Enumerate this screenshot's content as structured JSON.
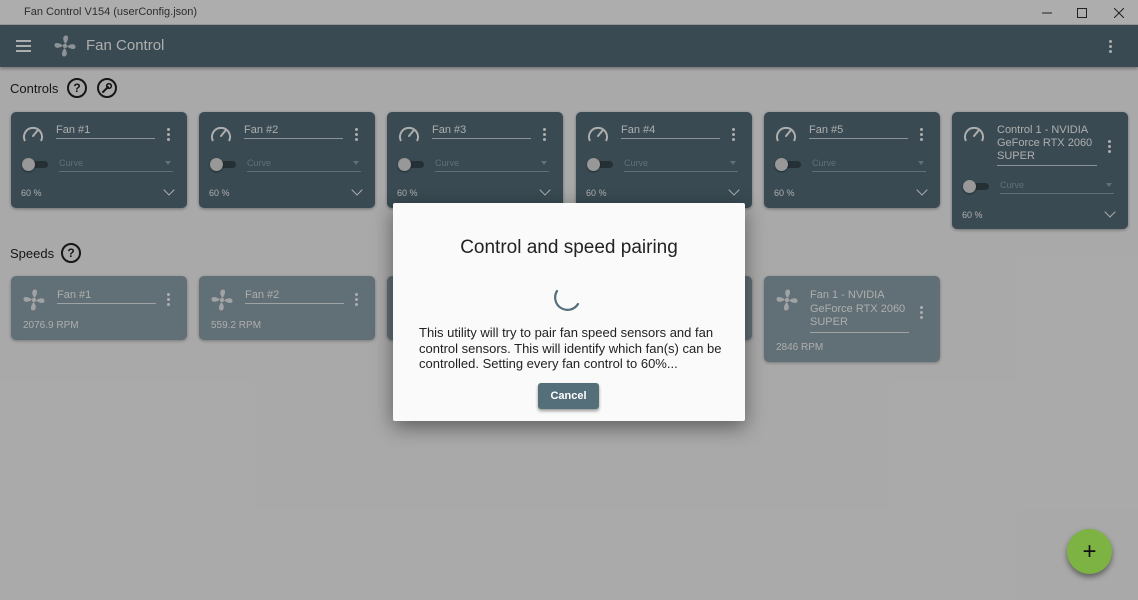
{
  "window": {
    "title": "Fan Control V154 (userConfig.json)"
  },
  "appbar": {
    "title": "Fan Control"
  },
  "sections": {
    "controls": "Controls",
    "speeds": "Speeds",
    "help_glyph": "?"
  },
  "controls": [
    {
      "name": "Fan #1",
      "curve_placeholder": "Curve",
      "percent": "60 %"
    },
    {
      "name": "Fan #2",
      "curve_placeholder": "Curve",
      "percent": "60 %"
    },
    {
      "name": "Fan #3",
      "curve_placeholder": "Curve",
      "percent": "60 %"
    },
    {
      "name": "Fan #4",
      "curve_placeholder": "Curve",
      "percent": "60 %"
    },
    {
      "name": "Fan #5",
      "curve_placeholder": "Curve",
      "percent": "60 %"
    },
    {
      "name": "Control 1 - NVIDIA GeForce RTX 2060 SUPER",
      "curve_placeholder": "Curve",
      "percent": "60 %"
    }
  ],
  "speeds": [
    {
      "name": "Fan #1",
      "rpm": "2076.9 RPM"
    },
    {
      "name": "Fan #2",
      "rpm": "559.2 RPM"
    },
    {
      "name": "Fan 1 - NVIDIA GeForce RTX 2060 SUPER",
      "rpm": "2846 RPM"
    }
  ],
  "dialog": {
    "title": "Control and speed pairing",
    "message": "This utility will try to pair fan speed sensors and fan control sensors. This will identify which fan(s) can be controlled. Setting every fan control to 60%...",
    "cancel_label": "Cancel"
  },
  "fab": {
    "glyph": "+"
  },
  "colors": {
    "primary": "#546e7a",
    "speed_card": "#90a4ae",
    "accent": "#7cb342"
  }
}
